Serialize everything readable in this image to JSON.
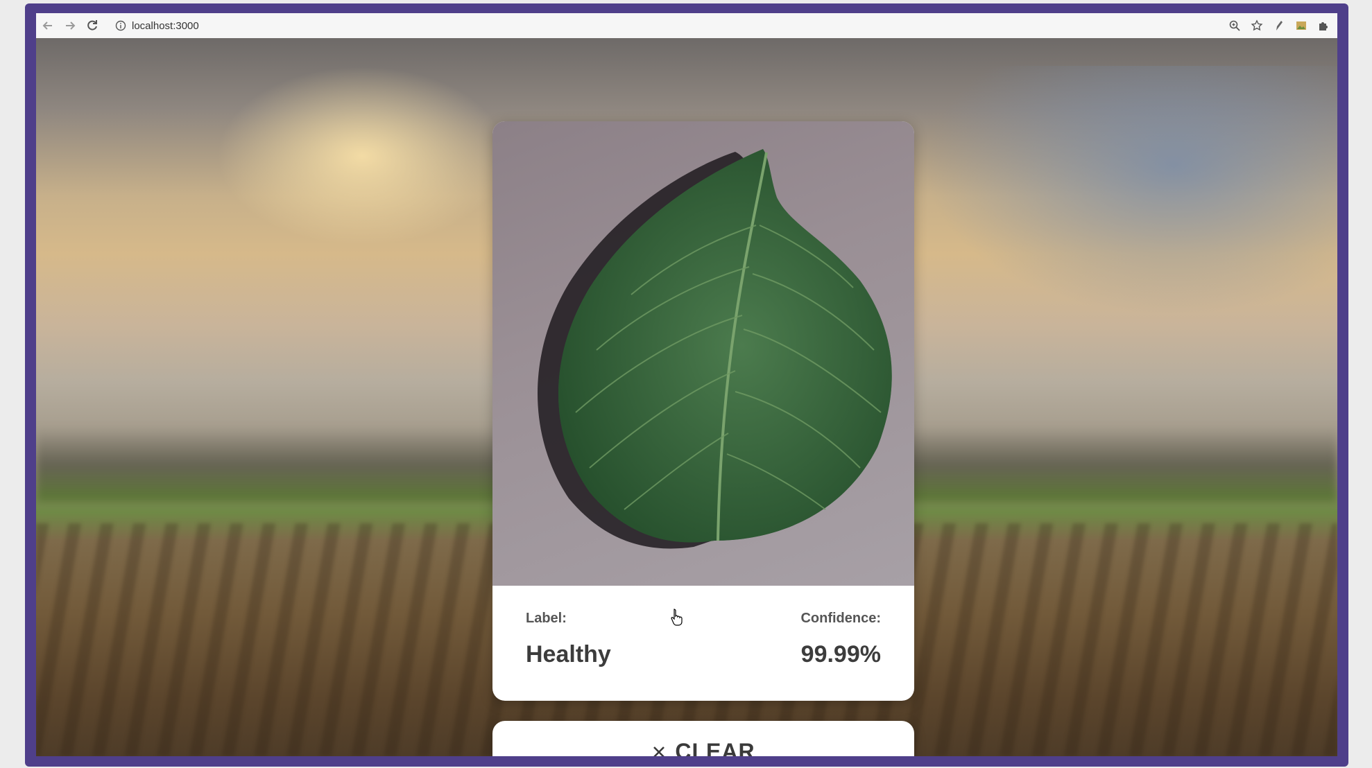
{
  "browser": {
    "url": "localhost:3000"
  },
  "result": {
    "label_key": "Label:",
    "label_value": "Healthy",
    "confidence_key": "Confidence:",
    "confidence_value": "99.99%"
  },
  "clear_button": {
    "label": "CLEAR"
  },
  "colors": {
    "frame": "#4f3f8a",
    "card_background": "#ffffff",
    "text": "#3c3c3c"
  },
  "icons": {
    "back": "arrow-left-icon",
    "forward": "arrow-right-icon",
    "reload": "reload-icon",
    "site_info": "info-icon",
    "zoom": "zoom-icon",
    "bookmark": "star-icon",
    "extension1": "pen-icon",
    "extension2": "image-icon",
    "extensions": "puzzle-icon",
    "clear": "close-icon"
  }
}
